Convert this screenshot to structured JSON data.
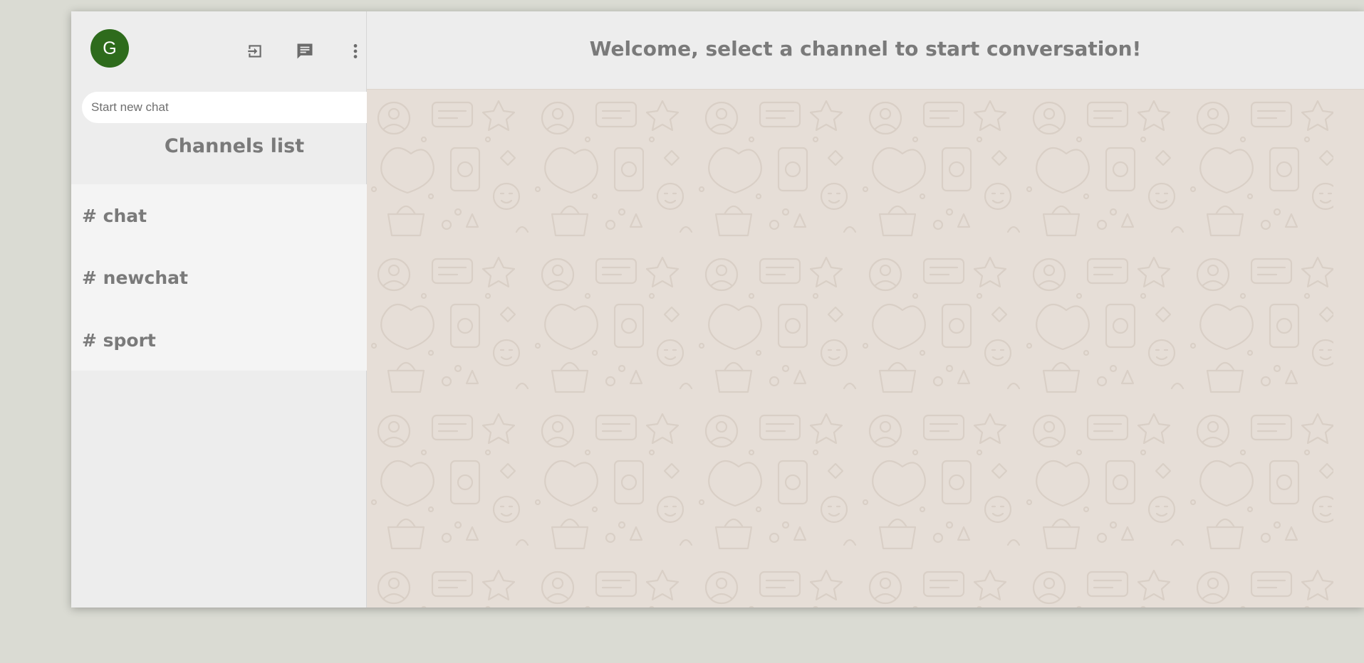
{
  "user": {
    "avatar_initial": "G",
    "avatar_color": "#2e6b1c"
  },
  "header_icons": [
    "logout-icon",
    "chat-icon",
    "more-vert-icon"
  ],
  "search": {
    "placeholder": "Start new chat",
    "value": "",
    "add_icon": "add-circle-icon"
  },
  "channels": {
    "title": "Channels list",
    "items": [
      {
        "label": "# chat"
      },
      {
        "label": "# newchat"
      },
      {
        "label": "# sport"
      }
    ]
  },
  "main": {
    "welcome_text": "Welcome, select a channel to start conversation!",
    "background_color": "#e6ded7"
  },
  "colors": {
    "page_background": "#dadbd3",
    "panel_background": "#ededed",
    "list_background": "#f4f4f4",
    "text_gray": "#7a7a7a"
  }
}
